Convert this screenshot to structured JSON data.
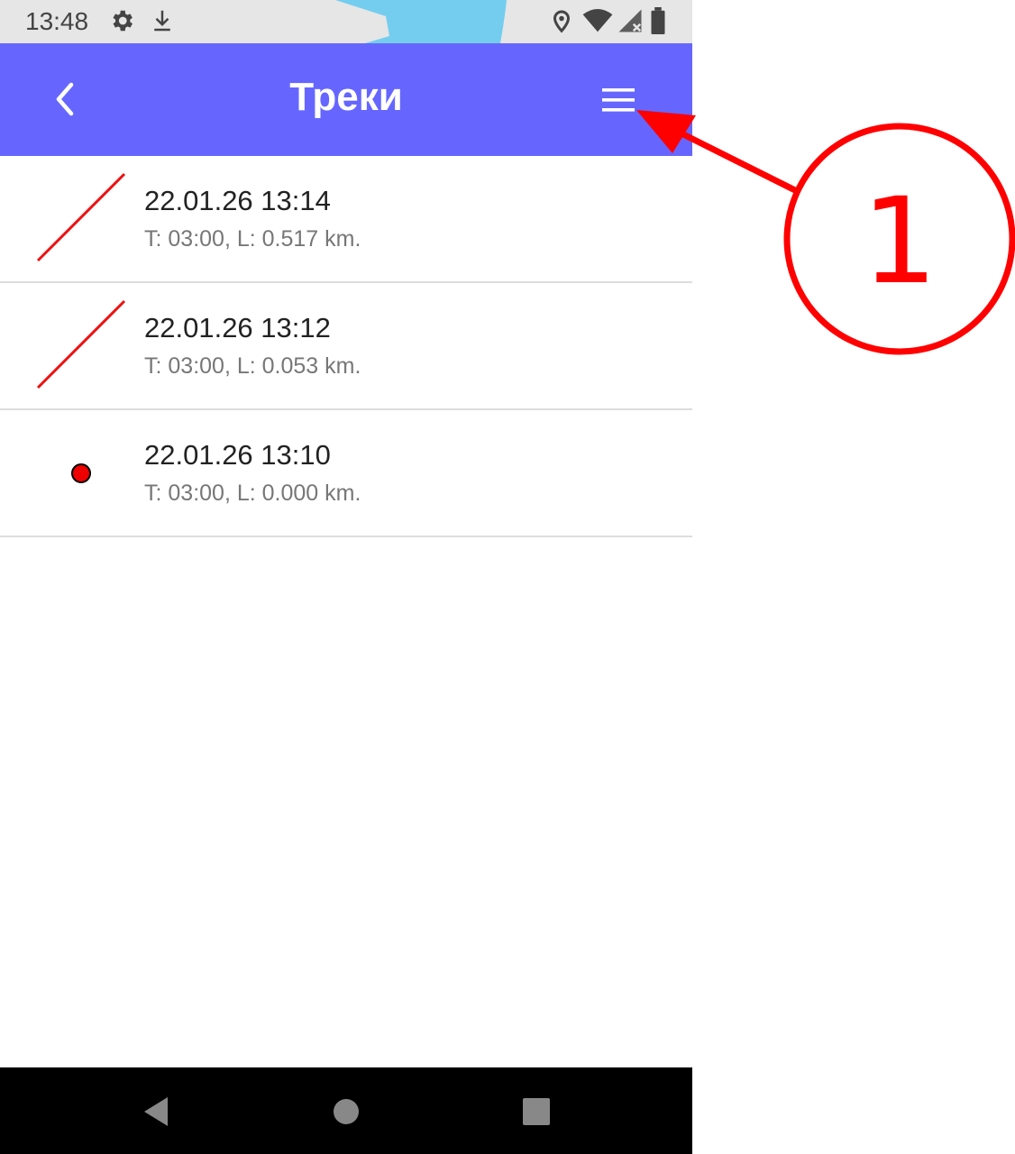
{
  "status_bar": {
    "time": "13:48",
    "icons": [
      "gear-icon",
      "download-icon",
      "location-icon",
      "wifi-icon",
      "signal-icon",
      "battery-icon"
    ]
  },
  "app_bar": {
    "title": "Треки",
    "back_icon": "chevron-left-icon",
    "menu_icon": "hamburger-menu-icon",
    "color": "#6666ff"
  },
  "tracks": [
    {
      "title": "22.01.26 13:14",
      "subtitle": "T: 03:00, L: 0.517 km.",
      "thumbnail": "line"
    },
    {
      "title": "22.01.26 13:12",
      "subtitle": "T: 03:00, L: 0.053 km.",
      "thumbnail": "line"
    },
    {
      "title": "22.01.26 13:10",
      "subtitle": "T: 03:00, L: 0.000 km.",
      "thumbnail": "dot"
    }
  ],
  "nav_bar": {
    "icons": [
      "back-triangle-icon",
      "home-circle-icon",
      "recents-square-icon"
    ]
  },
  "annotation": {
    "label": "1",
    "color": "#ff0000"
  }
}
